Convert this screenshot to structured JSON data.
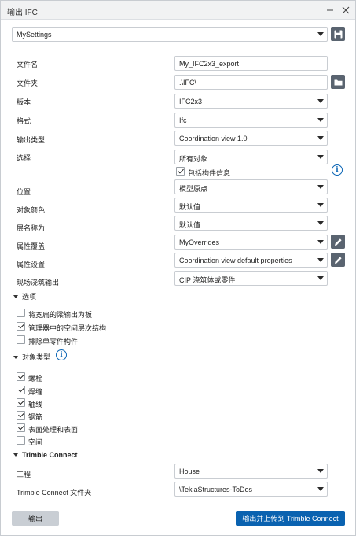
{
  "window": {
    "title": "输出 IFC"
  },
  "settings_select": {
    "value": "MySettings"
  },
  "fields": {
    "file_name": {
      "label": "文件名",
      "value": "My_IFC2x3_export"
    },
    "folder": {
      "label": "文件夹",
      "value": ".\\IFC\\"
    },
    "version": {
      "label": "版本",
      "value": "IFC2x3"
    },
    "format": {
      "label": "格式",
      "value": "Ifc"
    },
    "export_type": {
      "label": "输出类型",
      "value": "Coordination view 1.0"
    },
    "selection": {
      "label": "选择",
      "value": "所有对象"
    },
    "include_assembly": {
      "label": "包括构件信息",
      "checked": true
    },
    "location": {
      "label": "位置",
      "value": "模型原点"
    },
    "object_color": {
      "label": "对象颜色",
      "value": "默认值"
    },
    "layer_name": {
      "label": "层名称为",
      "value": "默认值"
    },
    "property_override": {
      "label": "属性覆盖",
      "value": "MyOverrides"
    },
    "property_sets": {
      "label": "属性设置",
      "value": "Coordination view default properties"
    },
    "pour_export": {
      "label": "现场浇筑输出",
      "value": "CIP 浇筑体或零件"
    }
  },
  "options": {
    "title": "选项",
    "items": [
      {
        "label": "将宽扁的梁输出为板",
        "checked": false
      },
      {
        "label": "管理器中的空间层次结构",
        "checked": true
      },
      {
        "label": "排除单零件构件",
        "checked": false
      }
    ]
  },
  "object_types": {
    "title": "对象类型",
    "items": [
      {
        "label": "螺栓",
        "checked": true
      },
      {
        "label": "焊缝",
        "checked": true
      },
      {
        "label": "轴线",
        "checked": true
      },
      {
        "label": "钢筋",
        "checked": true
      },
      {
        "label": "表面处理和表面",
        "checked": true
      },
      {
        "label": "空间",
        "checked": false
      }
    ]
  },
  "trimble_connect": {
    "title": "Trimble Connect",
    "project": {
      "label": "工程",
      "value": "House"
    },
    "folder": {
      "label": "Trimble Connect 文件夹",
      "value": "\\TeklaStructures-ToDos"
    }
  },
  "buttons": {
    "export": "输出",
    "export_upload": "输出并上传到 Trimble Connect"
  },
  "icons": {
    "save": "save-icon",
    "folder": "folder-icon",
    "edit": "pencil-icon",
    "info": "info-icon"
  },
  "colors": {
    "accent": "#0a62b0",
    "icon_button": "#5a6470",
    "info": "#0a65b5"
  }
}
